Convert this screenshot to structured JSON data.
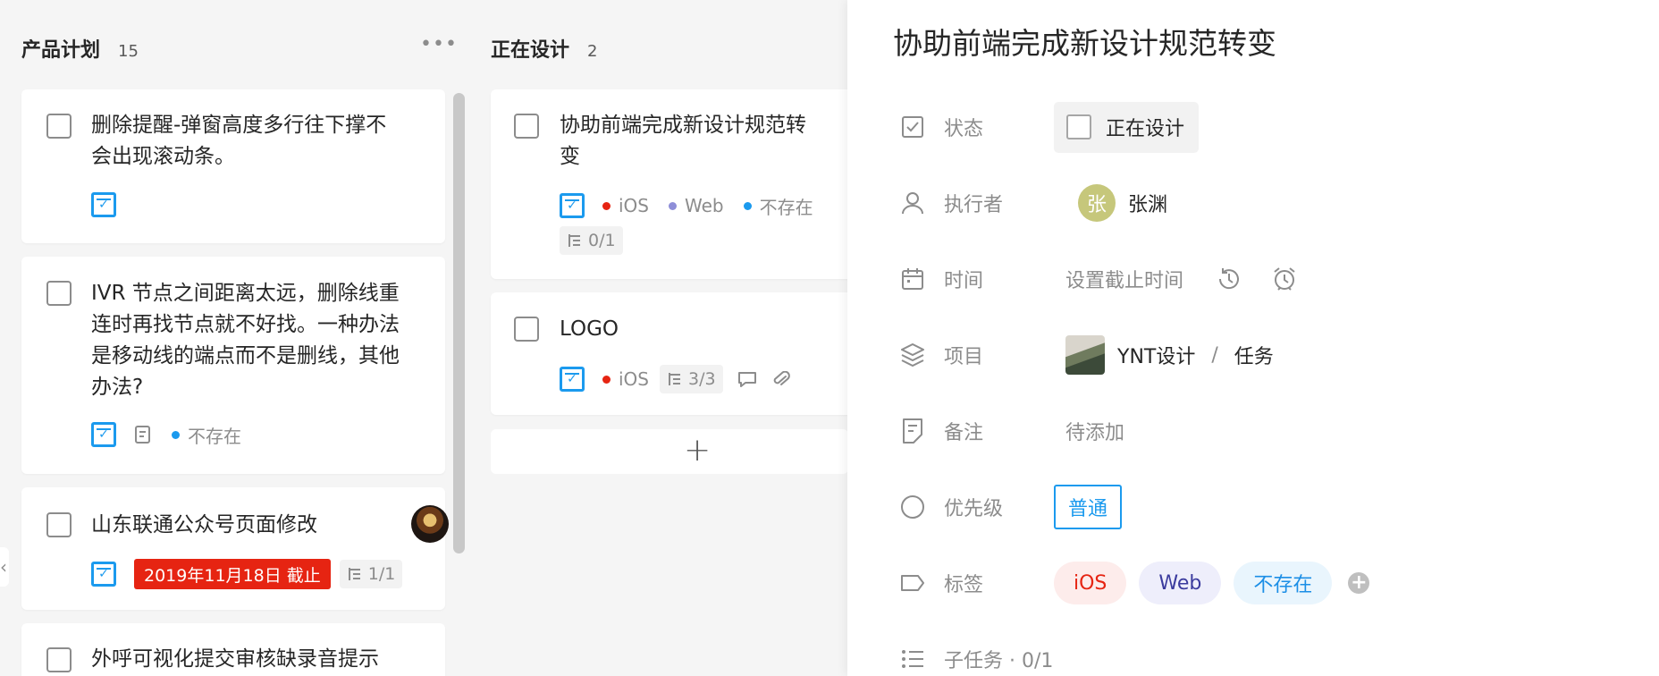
{
  "columns": [
    {
      "title": "产品计划",
      "count": "15",
      "cards": [
        {
          "title_line1": "删除提醒-弹窗高度多行往下撑不",
          "title_line2": "会出现滚动条。"
        },
        {
          "title_lines": [
            "IVR 节点之间距离太远，删除线重",
            "连时再找节点就不好找。一种办法",
            "是移动线的端点而不是删线，其他",
            "办法?"
          ],
          "tag": "不存在"
        },
        {
          "title": "山东联通公众号页面修改",
          "due": "2019年11月18日 截止",
          "subtasks": "1/1"
        },
        {
          "title": "外呼可视化提交审核缺录音提示"
        }
      ]
    },
    {
      "title": "正在设计",
      "count": "2",
      "cards": [
        {
          "title_line1": "协助前端完成新设计规范转",
          "title_line2": "变",
          "tags": [
            "iOS",
            "Web",
            "不存在"
          ],
          "subtasks": "0/1"
        },
        {
          "title": "LOGO",
          "tags": [
            "iOS"
          ],
          "subtasks": "3/3"
        }
      ]
    }
  ],
  "panel": {
    "title": "协助前端完成新设计规范转变",
    "fields": {
      "status": {
        "label": "状态",
        "value": "正在设计"
      },
      "assignee": {
        "label": "执行者",
        "avatar_letter": "张",
        "value": "张渊"
      },
      "time": {
        "label": "时间",
        "value": "设置截止时间"
      },
      "project": {
        "label": "项目",
        "value": "YNT设计",
        "separator": "/",
        "group": "任务"
      },
      "note": {
        "label": "备注",
        "value": "待添加"
      },
      "priority": {
        "label": "优先级",
        "value": "普通"
      },
      "tags": {
        "label": "标签",
        "values": [
          "iOS",
          "Web",
          "不存在"
        ]
      },
      "subtasks": {
        "label": "子任务 · 0/1"
      }
    }
  },
  "colors": {
    "accent": "#1b9aee",
    "ios": "#e62412",
    "web": "#8e8ed8",
    "not_exist": "#1b9aee",
    "due": "#e62412"
  },
  "icons": [
    "more-icon",
    "task-type-icon",
    "note-icon",
    "subtask-icon",
    "comment-icon",
    "attachment-icon",
    "add-icon",
    "checkbox-icon",
    "user-icon",
    "calendar-icon",
    "history-icon",
    "alarm-icon",
    "layers-icon",
    "memo-icon",
    "circle-icon",
    "tag-icon",
    "list-icon"
  ]
}
